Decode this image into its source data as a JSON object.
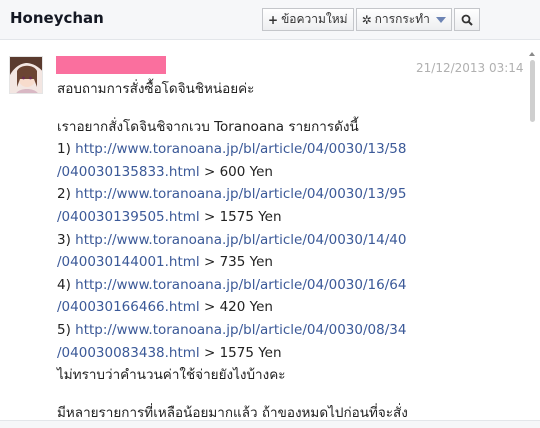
{
  "header": {
    "title": "Honeychan",
    "new_message_label": "ข้อความใหม่",
    "new_message_icon": "plus-icon",
    "actions_label": "การกระทำ",
    "actions_icon": "gear-icon",
    "search_icon": "search-icon"
  },
  "message": {
    "sender_redacted_color": "#fa6f9e",
    "timestamp": "21/12/2013 03:14",
    "greeting": "สอบถามการสั่งซื้อโดจินชิหน่อยค่ะ",
    "intro": "เราอยากสั่งโดจินชิจากเวบ Toranoana รายการดังนี้",
    "items": [
      {
        "num": "1)",
        "url_line1": "http://www.toranoana.jp/bl/article/04/0030/13/58",
        "url_line2": "/040030135833.html",
        "price": "> 600 Yen"
      },
      {
        "num": "2)",
        "url_line1": "http://www.toranoana.jp/bl/article/04/0030/13/95",
        "url_line2": "/040030139505.html",
        "price": "> 1575 Yen"
      },
      {
        "num": "3)",
        "url_line1": "http://www.toranoana.jp/bl/article/04/0030/14/40",
        "url_line2": "/040030144001.html",
        "price": "> 735 Yen"
      },
      {
        "num": "4)",
        "url_line1": "http://www.toranoana.jp/bl/article/04/0030/16/64",
        "url_line2": "/040030166466.html",
        "price": "> 420 Yen"
      },
      {
        "num": "5)",
        "url_line1": "http://www.toranoana.jp/bl/article/04/0030/08/34",
        "url_line2": "/040030083438.html",
        "price": "> 1575 Yen"
      }
    ],
    "question": "ไม่ทราบว่าคำนวนค่าใช้จ่ายยังไงบ้างคะ",
    "closing": "มีหลายรายการที่เหลือน้อยมากแล้ว ถ้าของหมดไปก่อนที่จะสั่ง"
  },
  "colors": {
    "link": "#3b5998",
    "header_bg": "#f6f7f9",
    "timestamp": "#b0b0b0"
  }
}
